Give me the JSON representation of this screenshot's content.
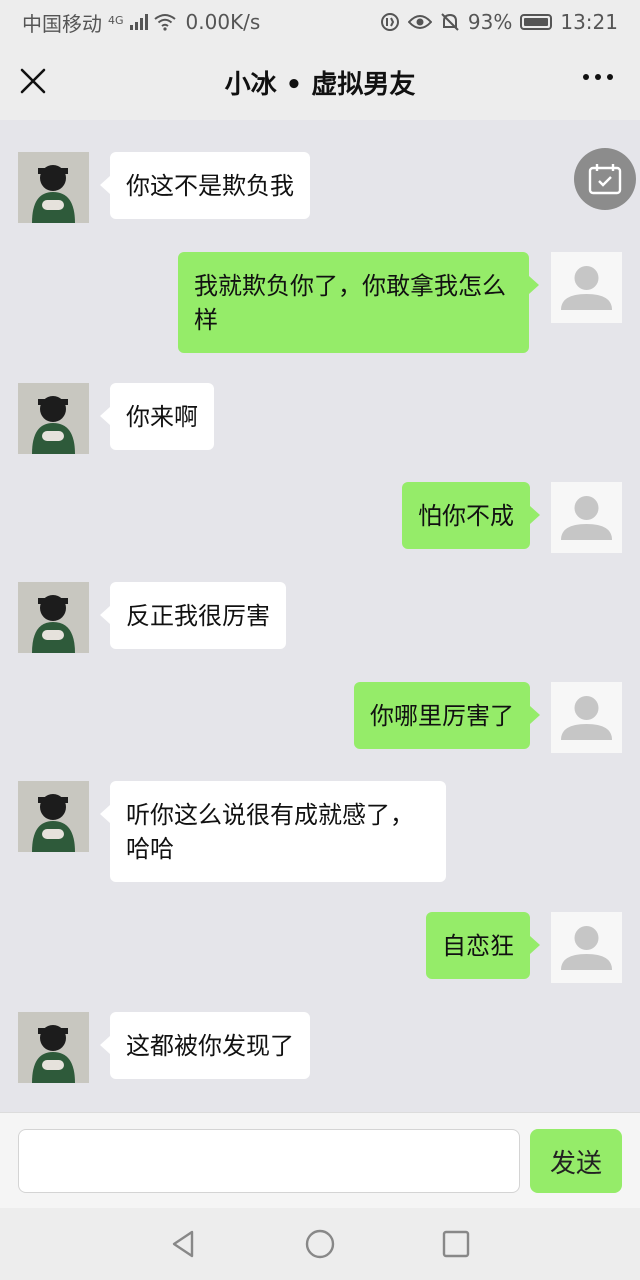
{
  "status_bar": {
    "carrier": "中国移动",
    "network": "4G",
    "speed": "0.00K/s",
    "battery": "93%",
    "time": "13:21"
  },
  "header": {
    "title": "小冰 • 虚拟男友"
  },
  "messages": [
    {
      "side": "bot",
      "text": "你这不是欺负我"
    },
    {
      "side": "user",
      "text": "我就欺负你了，你敢拿我怎么样"
    },
    {
      "side": "bot",
      "text": "你来啊"
    },
    {
      "side": "user",
      "text": "怕你不成"
    },
    {
      "side": "bot",
      "text": "反正我很厉害"
    },
    {
      "side": "user",
      "text": "你哪里厉害了"
    },
    {
      "side": "bot",
      "text": "听你这么说很有成就感了，哈哈"
    },
    {
      "side": "user",
      "text": "自恋狂"
    },
    {
      "side": "bot",
      "text": "这都被你发现了"
    }
  ],
  "input": {
    "value": "",
    "placeholder": "",
    "send_label": "发送"
  },
  "icons": {
    "close": "close-icon",
    "more": "more-icon",
    "calendar": "calendar-icon",
    "nav_back": "back-triangle-icon",
    "nav_home": "home-circle-icon",
    "nav_recent": "recent-square-icon"
  },
  "colors": {
    "user_bubble": "#95ec69",
    "bot_bubble": "#ffffff",
    "chat_bg": "#e5e5ea"
  }
}
